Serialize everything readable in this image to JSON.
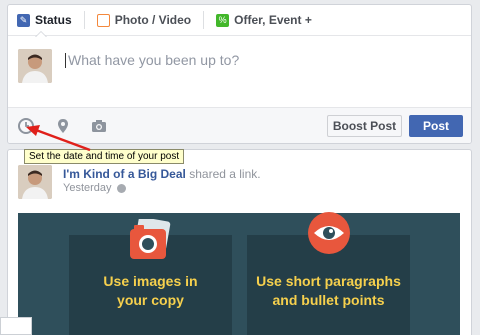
{
  "composer": {
    "tabs": [
      {
        "label": "Status",
        "icon": "pencil-icon"
      },
      {
        "label": "Photo / Video",
        "icon": "photo-icon"
      },
      {
        "label": "Offer, Event +",
        "icon": "offer-icon"
      }
    ],
    "placeholder": "What have you been up to?",
    "boost_label": "Boost Post",
    "post_label": "Post"
  },
  "tooltip": {
    "text": "Set the date and time of your post"
  },
  "story": {
    "actor": "I'm Kind of a Big Deal",
    "verb": "shared a link.",
    "time": "Yesterday",
    "cards": [
      {
        "title_line1": "Use images in",
        "title_line2": "your copy"
      },
      {
        "title_line1": "Use short paragraphs",
        "title_line2": "and bullet points"
      }
    ]
  },
  "colors": {
    "brand": "#4267b2",
    "accent_yellow": "#f6d04d",
    "tooltip_bg": "#ffffcc",
    "arrow_red": "#e0201b"
  }
}
